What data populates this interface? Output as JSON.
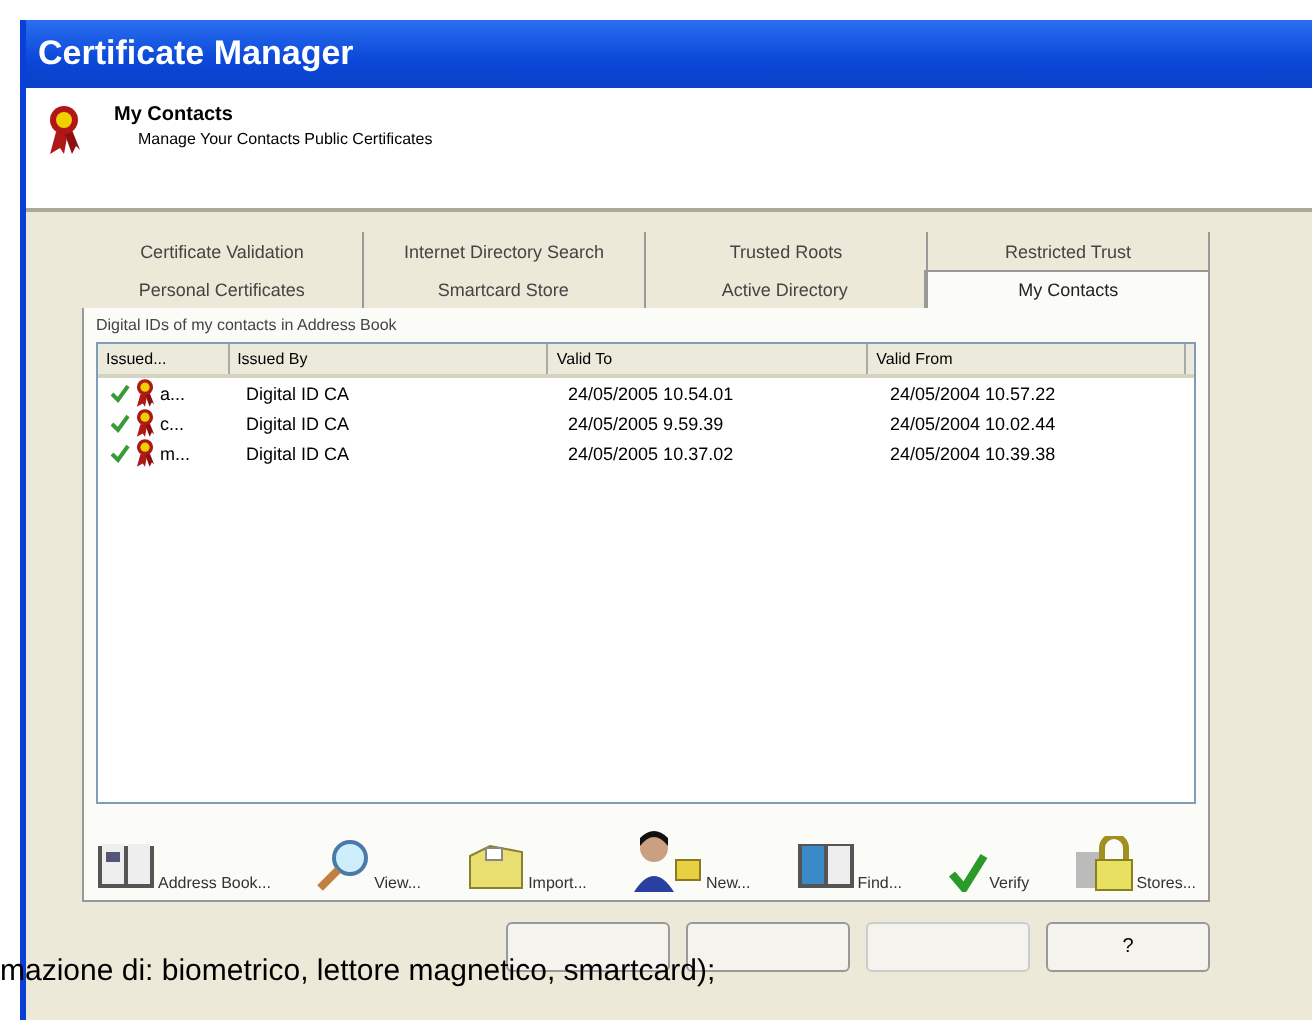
{
  "window": {
    "title": "Certificate Manager"
  },
  "header": {
    "title": "My Contacts",
    "subtitle": "Manage Your Contacts Public Certificates"
  },
  "tab_rows": [
    [
      {
        "label": "Certificate Validation",
        "selected": false
      },
      {
        "label": "Internet Directory Search",
        "selected": false
      },
      {
        "label": "Trusted Roots",
        "selected": false
      },
      {
        "label": "Restricted Trust",
        "selected": false
      }
    ],
    [
      {
        "label": "Personal Certificates",
        "selected": false
      },
      {
        "label": "Smartcard Store",
        "selected": false
      },
      {
        "label": "Active Directory",
        "selected": false
      },
      {
        "label": "My Contacts",
        "selected": true
      }
    ]
  ],
  "list_caption": "Digital IDs of my contacts in Address Book",
  "table": {
    "columns": [
      "Issued...",
      "Issued By",
      "Valid To",
      "Valid From"
    ],
    "rows": [
      {
        "valid": true,
        "cells": [
          "a...",
          "Digital ID CA",
          "24/05/2005 10.54.01",
          "24/05/2004 10.57.22"
        ]
      },
      {
        "valid": true,
        "cells": [
          "c...",
          "Digital ID CA",
          "24/05/2005 9.59.39",
          "24/05/2004 10.02.44"
        ]
      },
      {
        "valid": true,
        "cells": [
          "m...",
          "Digital ID CA",
          "24/05/2005 10.37.02",
          "24/05/2004 10.39.38"
        ]
      }
    ]
  },
  "toolbar": [
    {
      "kind": "book",
      "label": "Address Book..."
    },
    {
      "kind": "magnifier",
      "label": "View..."
    },
    {
      "kind": "folder",
      "label": "Import..."
    },
    {
      "kind": "people",
      "label": "New..."
    },
    {
      "kind": "find",
      "label": "Find..."
    },
    {
      "kind": "check",
      "label": "Verify"
    },
    {
      "kind": "lock",
      "label": "Stores..."
    }
  ],
  "buttons": [
    {
      "disabled": false
    },
    {
      "disabled": false
    },
    {
      "disabled": true
    },
    {
      "label": "?",
      "disabled": false
    }
  ],
  "overlay_text": "mazione di: biometrico, lettore magnetico, smartcard);"
}
